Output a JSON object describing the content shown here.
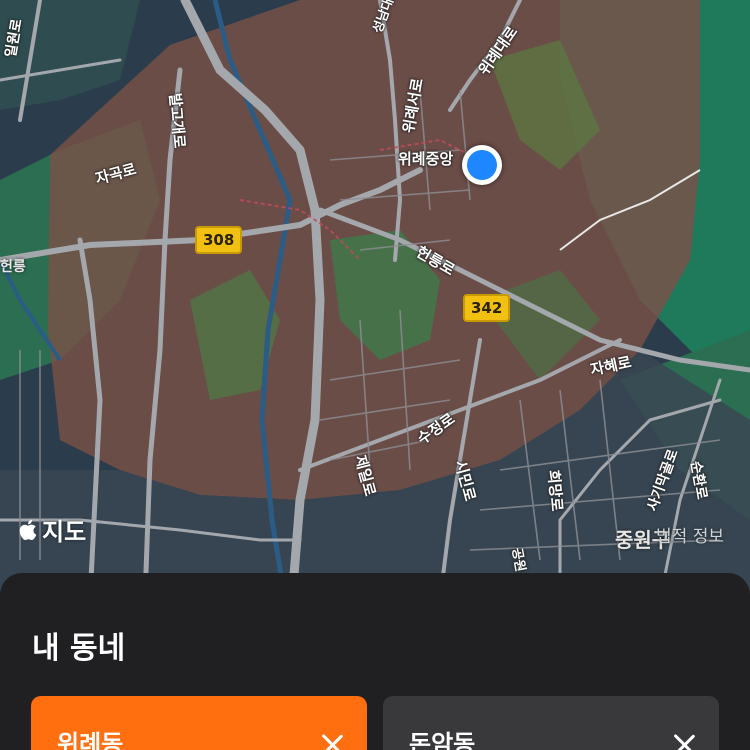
{
  "map": {
    "road_labels": [
      "위례대로",
      "위례서로",
      "위례중앙",
      "발고개로",
      "자곡로",
      "헌릉로",
      "자혜로",
      "수정로",
      "제일로",
      "시민로",
      "희망로",
      "성남대로",
      "공원",
      "사기막골로",
      "순환로",
      "헌릉",
      "일원로"
    ],
    "route_shields": [
      "308",
      "342"
    ],
    "area_label": "중원구",
    "maps_logo_text": "지도",
    "legal_text": "법적 정보",
    "colors": {
      "water_base": "#283a48",
      "forest_green": "#1e7a5a",
      "neighborhood_overlay": "#7a5048",
      "road": "#9ea3a8",
      "location_blue": "#1e86ff"
    }
  },
  "sheet": {
    "title": "내 동네",
    "chips": [
      {
        "label": "위례동",
        "selected": true,
        "color": "#ff6f0f"
      },
      {
        "label": "돈암동",
        "selected": false,
        "color": "#39393c"
      }
    ]
  }
}
